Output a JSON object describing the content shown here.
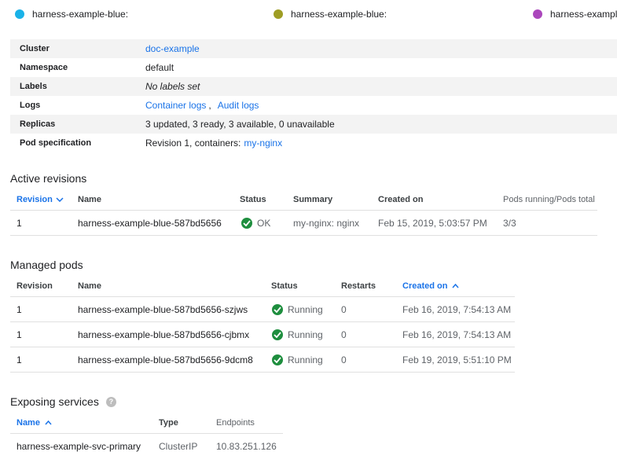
{
  "legend": [
    {
      "label": "harness-example-blue:",
      "color": "#1ab2e8"
    },
    {
      "label": "harness-example-blue:",
      "color": "#9e9d24"
    },
    {
      "label": "harness-example-blue:",
      "color": "#ab47bc"
    }
  ],
  "details": {
    "cluster_label": "Cluster",
    "cluster_value": "doc-example",
    "namespace_label": "Namespace",
    "namespace_value": "default",
    "labels_label": "Labels",
    "labels_value": "No labels set",
    "logs_label": "Logs",
    "logs_container": "Container logs",
    "logs_sep": ",",
    "logs_audit": "Audit logs",
    "replicas_label": "Replicas",
    "replicas_value": "3 updated, 3 ready, 3 available, 0 unavailable",
    "podspec_label": "Pod specification",
    "podspec_prefix": "Revision 1, containers:",
    "podspec_container": "my-nginx"
  },
  "active_revisions": {
    "title": "Active revisions",
    "columns": [
      "Revision",
      "Name",
      "Status",
      "Summary",
      "Created on",
      "Pods running/Pods total"
    ],
    "rows": [
      {
        "revision": "1",
        "name": "harness-example-blue-587bd5656",
        "status": "OK",
        "summary": "my-nginx: nginx",
        "created": "Feb 15, 2019, 5:03:57 PM",
        "pods": "3/3"
      }
    ]
  },
  "managed_pods": {
    "title": "Managed pods",
    "columns": [
      "Revision",
      "Name",
      "Status",
      "Restarts",
      "Created on"
    ],
    "rows": [
      {
        "revision": "1",
        "name": "harness-example-blue-587bd5656-szjws",
        "status": "Running",
        "restarts": "0",
        "created": "Feb 16, 2019, 7:54:13 AM"
      },
      {
        "revision": "1",
        "name": "harness-example-blue-587bd5656-cjbmx",
        "status": "Running",
        "restarts": "0",
        "created": "Feb 16, 2019, 7:54:13 AM"
      },
      {
        "revision": "1",
        "name": "harness-example-blue-587bd5656-9dcm8",
        "status": "Running",
        "restarts": "0",
        "created": "Feb 19, 2019, 5:51:10 PM"
      }
    ]
  },
  "services": {
    "title": "Exposing services",
    "help_glyph": "?",
    "columns": [
      "Name",
      "Type",
      "Endpoints"
    ],
    "rows": [
      {
        "name": "harness-example-svc-primary",
        "type": "ClusterIP",
        "endpoints": "10.83.251.126"
      }
    ]
  },
  "colors": {
    "link": "#1a73e8",
    "ok_green": "#1e8e3e",
    "alt_row": "#f3f3f3"
  },
  "icons": [
    "circle-dot-icon",
    "check-circle-icon",
    "chevron-down-icon",
    "arrow-up-icon",
    "help-icon"
  ]
}
